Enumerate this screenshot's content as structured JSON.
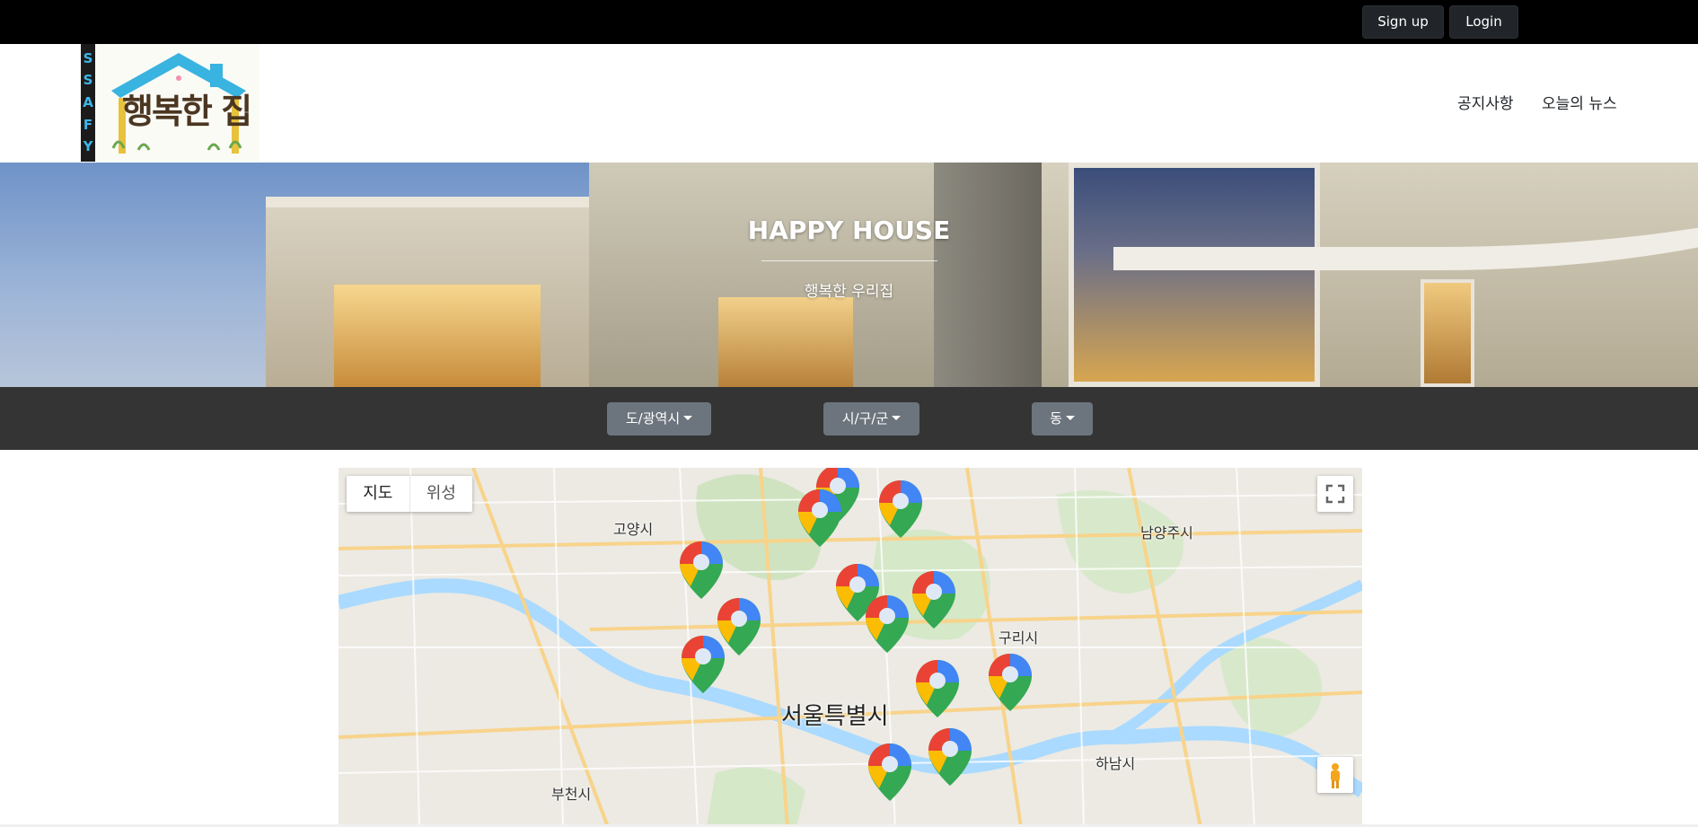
{
  "topbar": {
    "signup_label": "Sign up",
    "login_label": "Login"
  },
  "header": {
    "logo_letters": [
      "S",
      "S",
      "A",
      "F",
      "Y"
    ],
    "logo_text": "행복한 집",
    "nav": {
      "notice": "공지사항",
      "news": "오늘의 뉴스"
    }
  },
  "hero": {
    "title": "HAPPY HOUSE",
    "subtitle": "행복한 우리집"
  },
  "filters": {
    "province": "도/광역시",
    "city": "시/구/군",
    "dong": "동"
  },
  "map": {
    "type_map": "지도",
    "type_satellite": "위성",
    "labels": {
      "seoul": "서울특별시",
      "goyang": "고양시",
      "guri": "구리시",
      "namyangju": "남양주시",
      "hanam": "하남시",
      "bucheon": "부천시"
    },
    "marker_count": 13
  }
}
